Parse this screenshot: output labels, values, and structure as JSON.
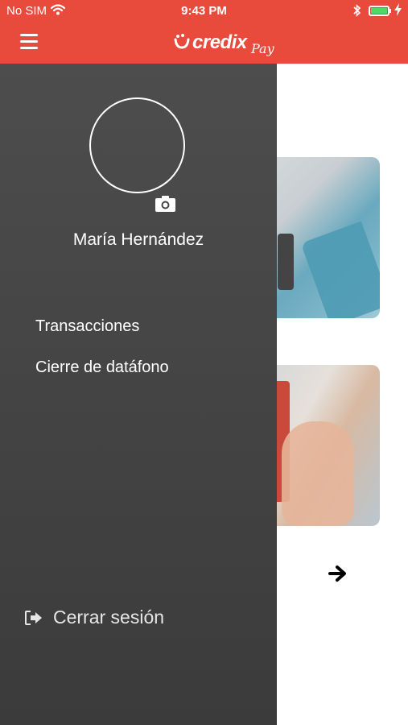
{
  "status_bar": {
    "carrier": "No SIM",
    "time": "9:43 PM",
    "battery_level": 1.0,
    "battery_color": "#4cd964",
    "icons": [
      "wifi-icon",
      "bluetooth-icon",
      "battery-icon",
      "charging-bolt-icon"
    ]
  },
  "header": {
    "logo_text": "credix",
    "logo_sub": "Pay",
    "accent_color": "#e84a3c",
    "icons": [
      "hamburger-menu-icon"
    ]
  },
  "drawer": {
    "user_name": "María Hernández",
    "menu_items": [
      {
        "label": "Transacciones"
      },
      {
        "label": "Cierre de datáfono"
      }
    ],
    "logout_label": "Cerrar sesión",
    "icons": [
      "camera-icon",
      "sign-out-icon"
    ]
  },
  "background": {
    "icons": [
      "arrow-right-icon"
    ]
  }
}
